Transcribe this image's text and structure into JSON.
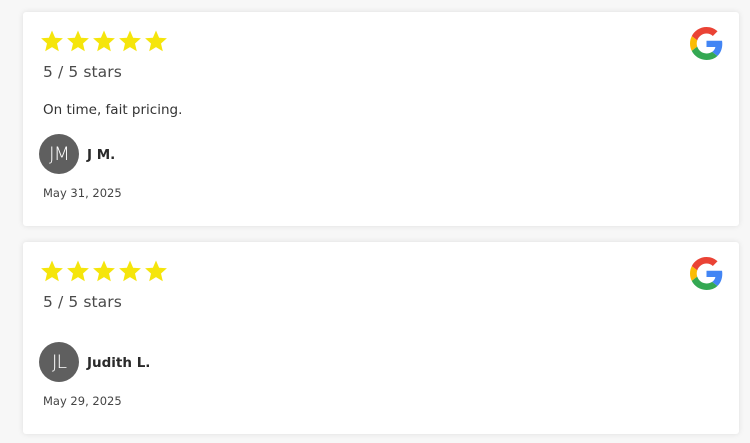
{
  "reviews": [
    {
      "rating": 5,
      "rating_text": "5 / 5 stars",
      "text": "On time, fait pricing.",
      "initials": "JM",
      "name": "J M.",
      "date": "May 31, 2025",
      "source_icon": "google-icon"
    },
    {
      "rating": 5,
      "rating_text": "5 / 5 stars",
      "text": "",
      "initials": "JL",
      "name": "Judith L.",
      "date": "May 29, 2025",
      "source_icon": "google-icon"
    }
  ],
  "colors": {
    "star": "#f5e50b",
    "avatar_bg": "#5f5f5f",
    "google_blue": "#4285F4",
    "google_red": "#EA4335",
    "google_yellow": "#FBBC05",
    "google_green": "#34A853"
  }
}
